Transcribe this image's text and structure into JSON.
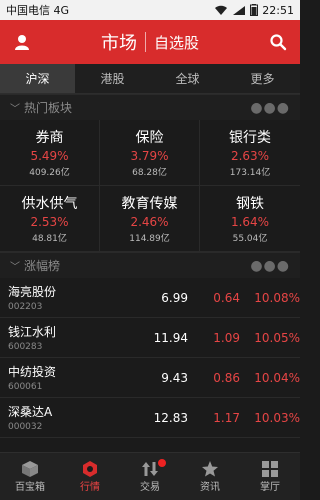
{
  "status": {
    "carrier": "中国电信",
    "network": "4G",
    "time": "22:51"
  },
  "header": {
    "title": "市场",
    "subtitle": "自选股"
  },
  "tabs": [
    "沪深",
    "港股",
    "全球",
    "更多"
  ],
  "sections": {
    "sectors_title": "热门板块",
    "ranking_title": "涨幅榜"
  },
  "sectors": [
    {
      "name": "券商",
      "pct": "5.49%",
      "amount": "409.26亿"
    },
    {
      "name": "保险",
      "pct": "3.79%",
      "amount": "68.28亿"
    },
    {
      "name": "银行类",
      "pct": "2.63%",
      "amount": "173.14亿"
    },
    {
      "name": "供水供气",
      "pct": "2.53%",
      "amount": "48.81亿"
    },
    {
      "name": "教育传媒",
      "pct": "2.46%",
      "amount": "114.89亿"
    },
    {
      "name": "钢铁",
      "pct": "1.64%",
      "amount": "55.04亿"
    }
  ],
  "stocks": [
    {
      "name": "海亮股份",
      "code": "002203",
      "price": "6.99",
      "change": "0.64",
      "pct": "10.08%"
    },
    {
      "name": "钱江水利",
      "code": "600283",
      "price": "11.94",
      "change": "1.09",
      "pct": "10.05%"
    },
    {
      "name": "中纺投资",
      "code": "600061",
      "price": "9.43",
      "change": "0.86",
      "pct": "10.04%"
    },
    {
      "name": "深桑达A",
      "code": "000032",
      "price": "12.83",
      "change": "1.17",
      "pct": "10.03%"
    }
  ],
  "bottom_nav": [
    {
      "label": "百宝箱",
      "icon": "box-icon"
    },
    {
      "label": "行情",
      "icon": "market-icon"
    },
    {
      "label": "交易",
      "icon": "trade-icon"
    },
    {
      "label": "资讯",
      "icon": "star-icon"
    },
    {
      "label": "掌厅",
      "icon": "grid-icon"
    }
  ],
  "colors": {
    "accent": "#d82c2c",
    "up": "#e64545"
  }
}
